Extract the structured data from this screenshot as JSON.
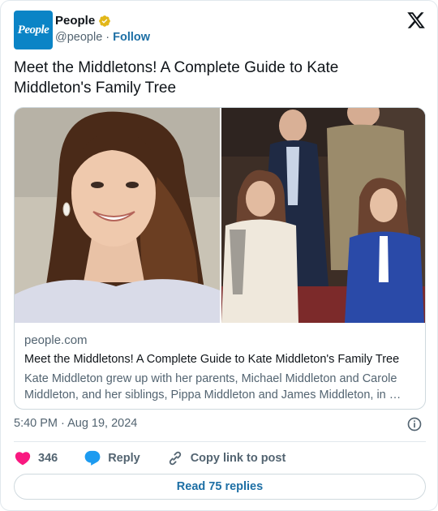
{
  "account": {
    "logo_text": "People",
    "name": "People",
    "handle": "@people",
    "separator": "·",
    "follow_label": "Follow"
  },
  "tweet": {
    "text": "Meet the Middletons! A Complete Guide to Kate Middleton's Family Tree"
  },
  "link_card": {
    "domain": "people.com",
    "title": "Meet the Middletons! A Complete Guide to Kate Middleton's Family Tree",
    "description": "Kate Middleton grew up with her parents, Michael Middleton and Carole Middleton, and her siblings, Pippa Middleton and James Middleton, in …"
  },
  "meta": {
    "timestamp": "5:40 PM · Aug 19, 2024"
  },
  "actions": {
    "like_count": "346",
    "reply_label": "Reply",
    "copy_label": "Copy link to post"
  },
  "read_replies_label": "Read 75 replies",
  "colors": {
    "accent": "#1d6fa5",
    "like": "#f91880",
    "reply": "#1d9bf0",
    "verified": "#e2b719",
    "logo_bg": "#0b84c6"
  },
  "icons": {
    "verified": "verified-badge-icon",
    "x_logo": "x-logo-icon",
    "info": "info-icon",
    "heart": "heart-icon",
    "reply": "reply-bubble-icon",
    "link": "link-icon"
  }
}
